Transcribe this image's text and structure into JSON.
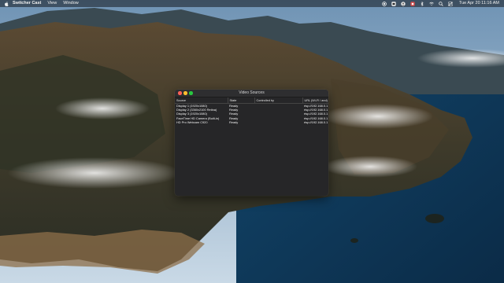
{
  "menubar": {
    "app_name": "Switcher Cast",
    "items": [
      "View",
      "Window"
    ],
    "status_icons": [
      "record-icon",
      "cast-icon",
      "user-icon",
      "app-icon",
      "bluetooth-icon",
      "wifi-icon",
      "search-icon",
      "control-center-icon"
    ],
    "clock": "Tue Apr 20  11:16 AM"
  },
  "window": {
    "title": "Video Sources",
    "columns": [
      "Source",
      "State",
      "Controlled by",
      "URL (Wi-Fi / and)"
    ],
    "rows": [
      {
        "source": "Display 1 (1920x1080)",
        "state": "Ready",
        "controlled_by": "",
        "url": "rtsp://192.168.0.1"
      },
      {
        "source": "Display 2 (3360x2100 Retina)",
        "state": "Ready",
        "controlled_by": "",
        "url": "rtsp://192.168.0.1"
      },
      {
        "source": "Display 3 (1920x1080)",
        "state": "Ready",
        "controlled_by": "",
        "url": "rtsp://192.168.0.1"
      },
      {
        "source": "FaceTime HD Camera (Built-in)",
        "state": "Ready",
        "controlled_by": "",
        "url": "rtsp://192.168.0.1"
      },
      {
        "source": "HD Pro Webcam C920",
        "state": "Ready",
        "controlled_by": "",
        "url": "rtsp://192.168.0.1"
      }
    ]
  },
  "colors": {
    "close": "#ff5f57",
    "minimize": "#febc2e",
    "maximize": "#28c840",
    "window_bg": "#262628"
  }
}
